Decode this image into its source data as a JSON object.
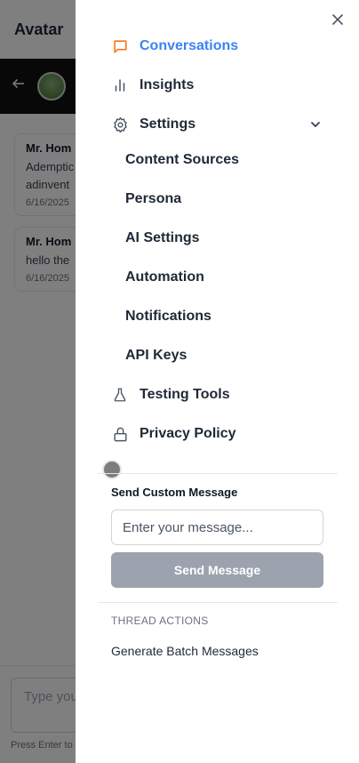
{
  "background": {
    "title": "Avatar",
    "cards": [
      {
        "name": "Mr. Hom",
        "text_line1": "Ademptic",
        "text_line2": "adinvent",
        "date": "6/16/2025"
      },
      {
        "name": "Mr. Hom",
        "text_line1": "hello the",
        "text_line2": "",
        "date": "6/16/2025"
      }
    ],
    "composer_placeholder": "Type you",
    "composer_hint": "Press Enter to"
  },
  "drawer": {
    "nav": {
      "conversations": "Conversations",
      "insights": "Insights",
      "settings": "Settings",
      "testing_tools": "Testing Tools",
      "privacy_policy": "Privacy Policy"
    },
    "settings_sub": {
      "content_sources": "Content Sources",
      "persona": "Persona",
      "ai_settings": "AI Settings",
      "automation": "Automation",
      "notifications": "Notifications",
      "api_keys": "API Keys"
    },
    "custom_message": {
      "title": "Send Custom Message",
      "placeholder": "Enter your message...",
      "value": "",
      "button": "Send Message"
    },
    "thread_actions": {
      "title": "THREAD ACTIONS",
      "generate": "Generate Batch Messages"
    }
  },
  "colors": {
    "active": "#3b82f6",
    "active_icon": "#f97316",
    "button_disabled": "#9ca3af"
  }
}
